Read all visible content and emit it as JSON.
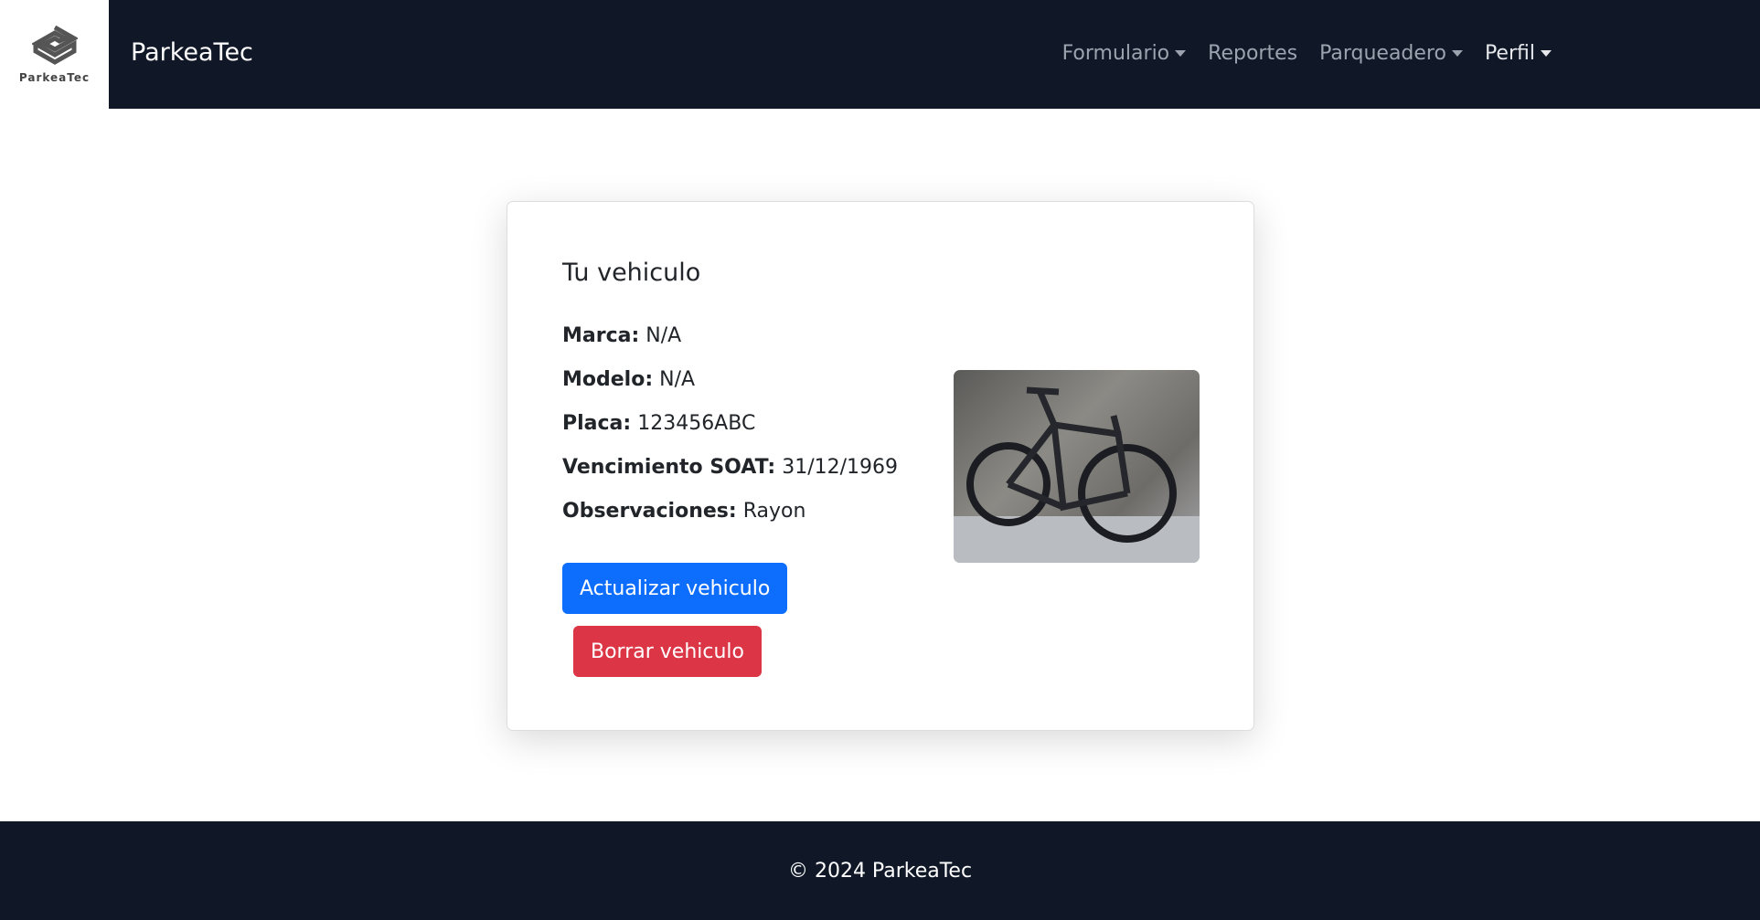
{
  "app": {
    "logo_text": "ParkeaTec",
    "brand": "ParkeaTec"
  },
  "nav": {
    "items": [
      {
        "label": "Formulario",
        "dropdown": true
      },
      {
        "label": "Reportes",
        "dropdown": false
      },
      {
        "label": "Parqueadero",
        "dropdown": true
      },
      {
        "label": "Perfil",
        "dropdown": true
      }
    ]
  },
  "card": {
    "title": "Tu vehiculo",
    "fields": [
      {
        "label": "Marca:",
        "value": "N/A"
      },
      {
        "label": "Modelo:",
        "value": "N/A"
      },
      {
        "label": "Placa:",
        "value": "123456ABC"
      },
      {
        "label": "Vencimiento SOAT:",
        "value": "31/12/1969"
      },
      {
        "label": "Observaciones:",
        "value": "Rayon"
      }
    ],
    "image": "bicycle photo",
    "update_label": "Actualizar vehiculo",
    "delete_label": "Borrar vehiculo"
  },
  "footer": {
    "text": "© 2024 ParkeaTec"
  },
  "colors": {
    "navbar": "#101828",
    "primary": "#0d6efd",
    "danger": "#dc3545"
  }
}
